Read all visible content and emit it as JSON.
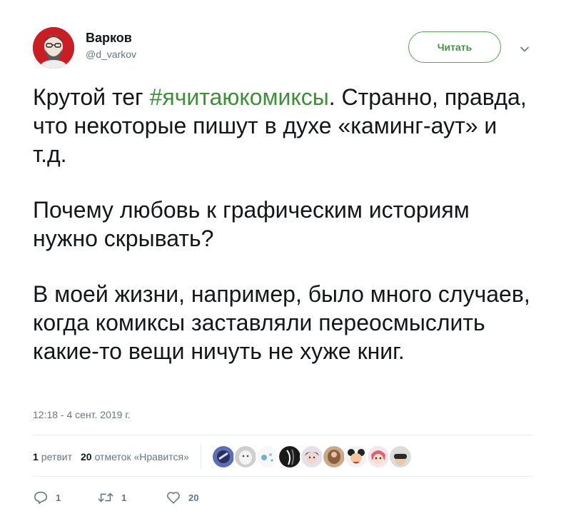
{
  "author": {
    "name": "Варков",
    "handle": "@d_varkov"
  },
  "follow_button": {
    "label": "Читать"
  },
  "tweet": {
    "text_before_hashtag": "Крутой тег ",
    "hashtag": "#ячитаюкомиксы",
    "text_after_hashtag": ". Странно, правда, что некоторые пишут в духе «каминг-аут» и т.д.",
    "paragraph_2": "Почему любовь к графическим историям нужно скрывать?",
    "paragraph_3": "В моей жизни, например, было много случаев, когда комиксы заставляли переосмыслить какие-то вещи ничуть не хуже книг."
  },
  "timestamp": "12:18 - 4 сент. 2019 г.",
  "stats": {
    "retweets_count": "1",
    "retweets_label": "ретвит",
    "likes_count": "20",
    "likes_label": "отметок «Нравится»"
  },
  "actions": {
    "reply_count": "1",
    "retweet_count": "1",
    "like_count": "20"
  },
  "colors": {
    "hashtag": "#3f8e3b",
    "follow_border": "#5aa25a",
    "muted": "#657786",
    "avatar_bg": "#c81e25"
  },
  "icons": [
    "chevron-down-icon",
    "reply-icon",
    "retweet-icon",
    "heart-icon"
  ]
}
